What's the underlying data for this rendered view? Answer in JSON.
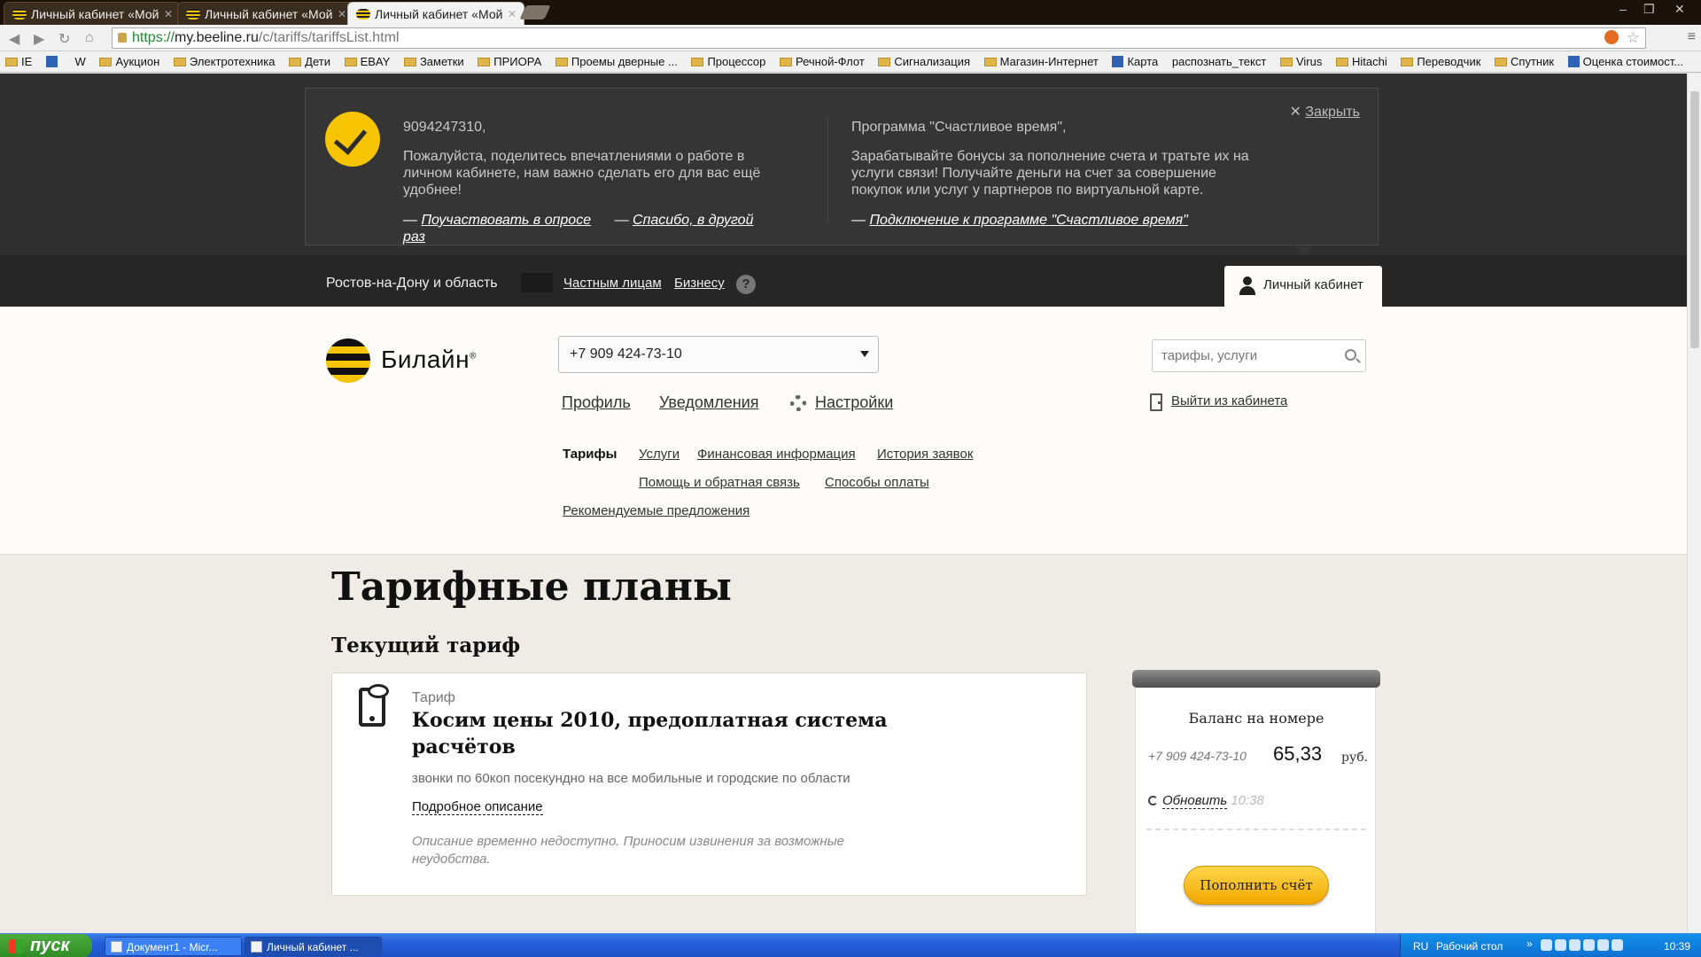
{
  "browser": {
    "tabs": [
      {
        "title": "Личный кабинет «Мой"
      },
      {
        "title": "Личный кабинет «Мой"
      },
      {
        "title": "Личный кабинет «Мой"
      }
    ],
    "url_scheme": "https://",
    "url_host": "my.beeline.ru",
    "url_path": "/c/tariffs/tariffsList.html",
    "bookmarks": [
      "IE",
      "W",
      "Аукцион",
      "Электротехника",
      "Дети",
      "EBAY",
      "Заметки",
      "ПРИОРА",
      "Проемы дверные ...",
      "Процессор",
      "Речной-Флот",
      "Сигнализация",
      "Магазин-Интернет",
      "Карта",
      "распознать_текст",
      "Virus",
      "Hitachi",
      "Переводчик",
      "Спутник",
      "Оценка стоимост..."
    ]
  },
  "promo": {
    "left": {
      "title": "9094247310,",
      "text": "Пожалуйста, поделитесь впечатлениями о работе в личном кабинете, нам важно сделать его для вас ещё удобнее!",
      "link_survey": "Поучаствовать в опросе",
      "link_later": "Спасибо, в другой раз"
    },
    "right": {
      "title": "Программа \"Счастливое время\",",
      "text": "Зарабатывайте бонусы за пополнение счета и тратьте их на услуги связи! Получайте деньги на счет за совершение покупок или услуг у партнеров по виртуальной карте.",
      "link": "Подключение к программе \"Счастливое время\""
    },
    "close_label": "Закрыть",
    "dash": "—"
  },
  "topnav": {
    "region": "Ростов-на-Дону и область",
    "private": "Частным лицам",
    "business": "Бизнесу",
    "help": "?",
    "account": "Личный кабинет"
  },
  "header": {
    "logo_text": "Билайн",
    "logo_mark": "®",
    "phone_selected": "+7 909 424-73-10",
    "search_placeholder": "тарифы, услуги",
    "main_menu": {
      "profile": "Профиль",
      "notifications": "Уведомления",
      "settings": "Настройки"
    },
    "logout": "Выйти из кабинета",
    "sub_menu": {
      "tariffs": "Тарифы",
      "services": "Услуги",
      "finance": "Финансовая информация",
      "history": "История заявок",
      "help": "Помощь и обратная связь",
      "payment": "Способы оплаты",
      "offers": "Рекомендуемые предложения"
    }
  },
  "content": {
    "page_title": "Тарифные планы",
    "section_title": "Текущий тариф",
    "tariff": {
      "label": "Тариф",
      "name": "Косим цены 2010, предоплатная система расчётов",
      "description": "звонки по 60коп посекундно на все мобильные и городские по области",
      "more_link": "Подробное описание",
      "unavailable": "Описание временно недоступно. Приносим извинения за возможные неудобства."
    }
  },
  "balance": {
    "title": "Баланс на номере",
    "phone": "+7 909 424-73-10",
    "amount": "65,33",
    "currency": "руб.",
    "refresh_label": "Обновить",
    "refresh_time": "10:38",
    "topup_label": "Пополнить счёт"
  },
  "taskbar": {
    "start": "пуск",
    "tasks": [
      "Документ1 - Micr...",
      "Личный кабинет ..."
    ],
    "lang": "RU",
    "desktop": "Рабочий стол",
    "chevron": "»",
    "clock": "10:39"
  }
}
